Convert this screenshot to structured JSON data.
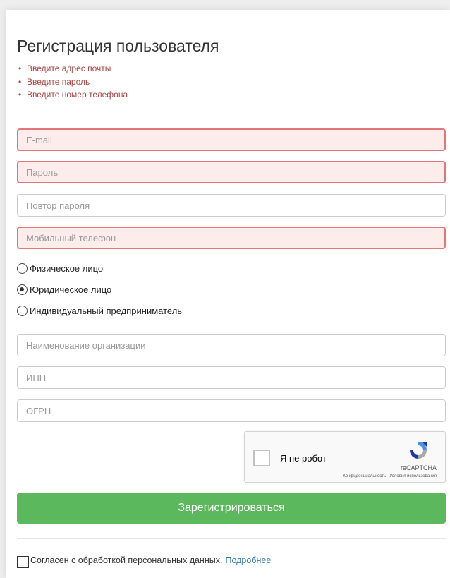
{
  "form": {
    "title": "Регистрация пользователя",
    "errors": [
      "Введите адрес почты",
      "Введите пароль",
      "Введите номер телефона"
    ],
    "fields": {
      "email": {
        "placeholder": "E-mail",
        "value": ""
      },
      "password": {
        "placeholder": "Пароль",
        "value": ""
      },
      "password_repeat": {
        "placeholder": "Повтор пароля",
        "value": ""
      },
      "phone": {
        "placeholder": "Мобильный телефон",
        "value": ""
      },
      "org_name": {
        "placeholder": "Наименование организации",
        "value": ""
      },
      "inn": {
        "placeholder": "ИНН",
        "value": ""
      },
      "ogrn": {
        "placeholder": "ОГРН",
        "value": ""
      }
    },
    "person_type": {
      "options": [
        "Физическое лицо",
        "Юридическое лицо",
        "Индивидуальный предприниматель"
      ],
      "selected": "Юридическое лицо"
    },
    "captcha": {
      "label": "Я не робот",
      "brand": "reCAPTCHA",
      "terms": "Конфиденциальность - Условия использования"
    },
    "submit_label": "Зарегистрироваться",
    "agreement": {
      "text": "Согласен с обработкой персональных данных.",
      "link": "Подробнее"
    }
  },
  "colors": {
    "error_text": "#a94442",
    "error_border": "#e27777",
    "error_bg": "#fdecec",
    "submit_bg": "#5cb85c",
    "link": "#337ab7"
  }
}
